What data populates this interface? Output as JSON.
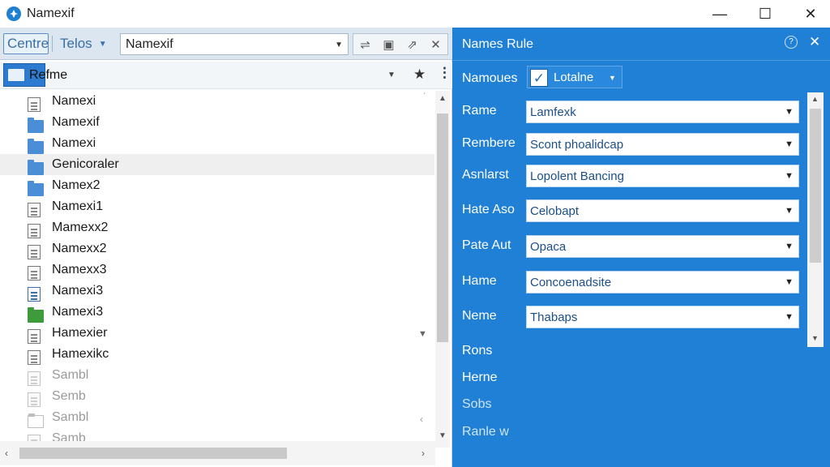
{
  "window": {
    "title": "Namexif",
    "controls": {
      "minimize": "—",
      "maximize": "☐",
      "close": "✕"
    }
  },
  "toolbar": {
    "centre_label": "Centre",
    "telos_label": "Telos",
    "path_value": "Namexif",
    "icons": [
      "sort-icon",
      "view-icon",
      "share-icon",
      "close-icon"
    ],
    "icon_glyphs": [
      "⇌",
      "▣",
      "⇗",
      "✕"
    ]
  },
  "file_header": {
    "label": "Refme",
    "star": "★",
    "more": "⋮"
  },
  "files": [
    {
      "name": "Namexi",
      "icon": "document-icon",
      "type": "doc"
    },
    {
      "name": "Namexif",
      "icon": "folder-icon",
      "type": "folder"
    },
    {
      "name": "Namexi",
      "icon": "folder-icon",
      "type": "folder"
    },
    {
      "name": "Genicoraler",
      "icon": "folder-icon",
      "type": "folder",
      "highlight": true
    },
    {
      "name": "Namex2",
      "icon": "folder-icon",
      "type": "folder"
    },
    {
      "name": "Namexi1",
      "icon": "document-icon",
      "type": "doc"
    },
    {
      "name": "Mamexx2",
      "icon": "document-icon",
      "type": "doc"
    },
    {
      "name": "Namexx2",
      "icon": "document-icon",
      "type": "doc"
    },
    {
      "name": "Namexx3",
      "icon": "document-icon",
      "type": "doc"
    },
    {
      "name": "Namexi3",
      "icon": "document-icon",
      "type": "doc-blue"
    },
    {
      "name": "Namexi3",
      "icon": "folder-icon",
      "type": "folder-green"
    },
    {
      "name": "Hamexier",
      "icon": "document-icon",
      "type": "doc"
    },
    {
      "name": "Hamexikc",
      "icon": "document-icon",
      "type": "doc"
    },
    {
      "name": "Sambl",
      "icon": "document-icon",
      "type": "doc-faint",
      "faded": true
    },
    {
      "name": "Semb",
      "icon": "document-icon",
      "type": "doc-faint",
      "faded": true
    },
    {
      "name": "Sambl",
      "icon": "folder-icon",
      "type": "folder-outline",
      "faded": true
    },
    {
      "name": "Samb",
      "icon": "document-icon",
      "type": "doc-faint",
      "faded": true
    }
  ],
  "rule_panel": {
    "title": "Names Rule",
    "help": "?",
    "close": "✕",
    "namoues_label": "Namoues",
    "namoues_checked": true,
    "namoues_option": "Lotalne",
    "fields": [
      {
        "label": "Rame",
        "value": "Lamfexk"
      },
      {
        "label": "Rembere",
        "value": "Scont phoalidcap"
      },
      {
        "label": "Asnlarst",
        "value": "Lopolent Bancing"
      },
      {
        "label": "Hate Aso",
        "value": "Celobapt"
      },
      {
        "label": "Pate Aut",
        "value": "Opaca"
      },
      {
        "label": "Hame",
        "value": "Concoenadsite"
      },
      {
        "label": "Neme",
        "value": "Thabaps"
      }
    ],
    "extra_labels": [
      "Rons",
      "Herne",
      "Sobs",
      "Ranle w"
    ]
  }
}
